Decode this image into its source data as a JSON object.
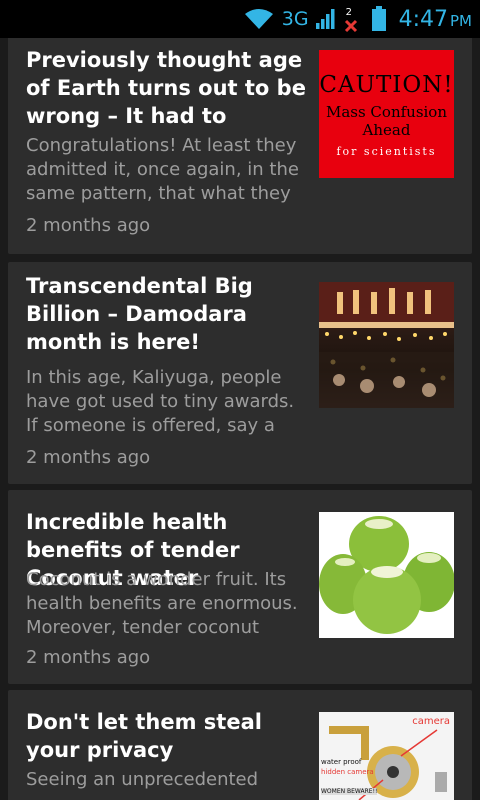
{
  "status_bar": {
    "network": "3G",
    "notif_count": "2",
    "time": "4:47",
    "ampm": "PM"
  },
  "articles": [
    {
      "title": "Previously thought age of Earth turns out to be wrong – It had to",
      "snippet": "Congratulations! At least they admitted it, once again, in the same pattern, that what they",
      "time": "2 months ago",
      "image": {
        "line1": "CAUTION!",
        "line2": "Mass Confusion",
        "line3": "Ahead",
        "line4": "for scientists"
      }
    },
    {
      "title": "Transcendental Big Billion – Damodara month is here!",
      "snippet": "In this age, Kaliyuga, people have got used to tiny awards. If someone is offered, say a",
      "time": "2 months ago"
    },
    {
      "title": "Incredible health benefits of tender Coconut water",
      "snippet": "Coconut is a wonder fruit. Its health benefits are enormous. Moreover, tender coconut",
      "time": "2 months ago"
    },
    {
      "title": "Don't let them steal your privacy",
      "snippet": "Seeing an unprecedented",
      "time": "",
      "image": {
        "label_camera": "camera",
        "label_water": "water proof",
        "label_hidden": "hidden camera",
        "label_women": "WOMEN BEWARE!!"
      }
    }
  ]
}
